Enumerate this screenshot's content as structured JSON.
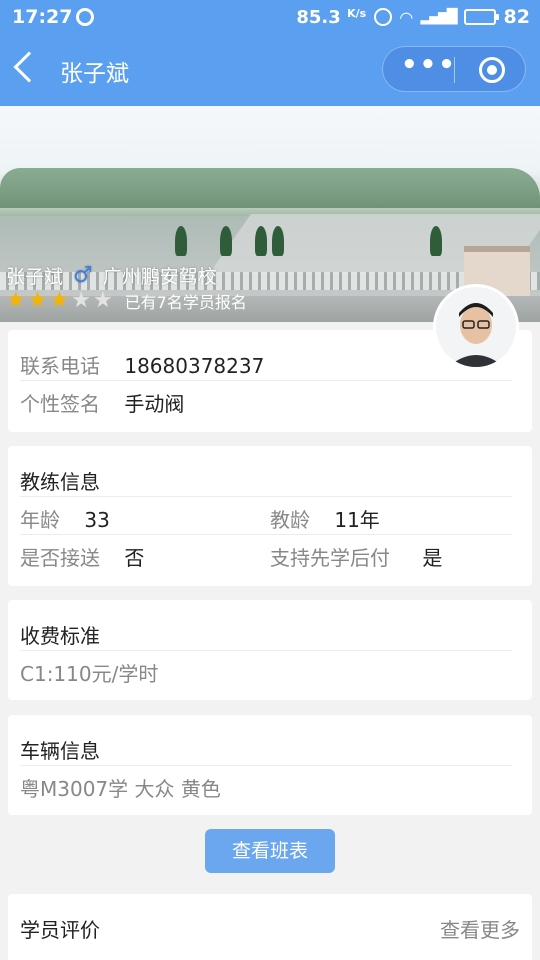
{
  "status_bar": {
    "time": "17:27",
    "network_speed": "85.3",
    "speed_unit": "K/s",
    "battery": "82",
    "battery_level": 0.82
  },
  "nav": {
    "title": "张子斌",
    "more_label": "•••"
  },
  "banner": {
    "coach_name": "张子斌",
    "gender_symbol": "♂",
    "school": "广州鹏安驾校",
    "rating": 3,
    "rating_max": 5,
    "enroll_text": "已有7名学员报名"
  },
  "contact": {
    "phone_label": "联系电话",
    "phone_value": "18680378237",
    "signature_label": "个性签名",
    "signature_value": "手动阀"
  },
  "coach_info": {
    "title": "教练信息",
    "age_label": "年龄",
    "age_value": "33",
    "teach_age_label": "教龄",
    "teach_age_value": "11年",
    "pickup_label": "是否接送",
    "pickup_value": "否",
    "learn_first_label": "支持先学后付",
    "learn_first_value": "是"
  },
  "fees": {
    "title": "收费标准",
    "value": "C1:110元/学时"
  },
  "vehicle": {
    "title": "车辆信息",
    "value": "粤M3007学 大众 黄色"
  },
  "schedule_button": "查看班表",
  "reviews": {
    "title": "学员评价",
    "more": "查看更多"
  },
  "colors": {
    "nav_bg": "#5a9ff0",
    "button_bg": "#6aa7ef",
    "star": "#f4b400"
  }
}
